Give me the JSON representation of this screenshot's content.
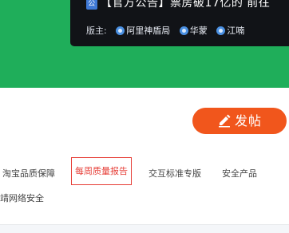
{
  "notice": {
    "icon_label": "公",
    "title": "【官方公告】票房破17亿的 前往"
  },
  "moderators": {
    "label": "版主:",
    "names": [
      "阿里神盾局",
      "华蒙",
      "江喃"
    ]
  },
  "post_button": {
    "label": "发帖",
    "icon": "pencil-icon"
  },
  "tabs": [
    {
      "label": "淘宝品质保障",
      "active": false
    },
    {
      "label": "每周质量报告",
      "active": true
    },
    {
      "label": "交互标准专版",
      "active": false
    },
    {
      "label": "安全产品",
      "active": false
    },
    {
      "label": "靖网络安全",
      "active": false
    }
  ],
  "colors": {
    "banner": "#1fae5a",
    "accent": "#f1561c",
    "active_tab": "#e63c35"
  }
}
